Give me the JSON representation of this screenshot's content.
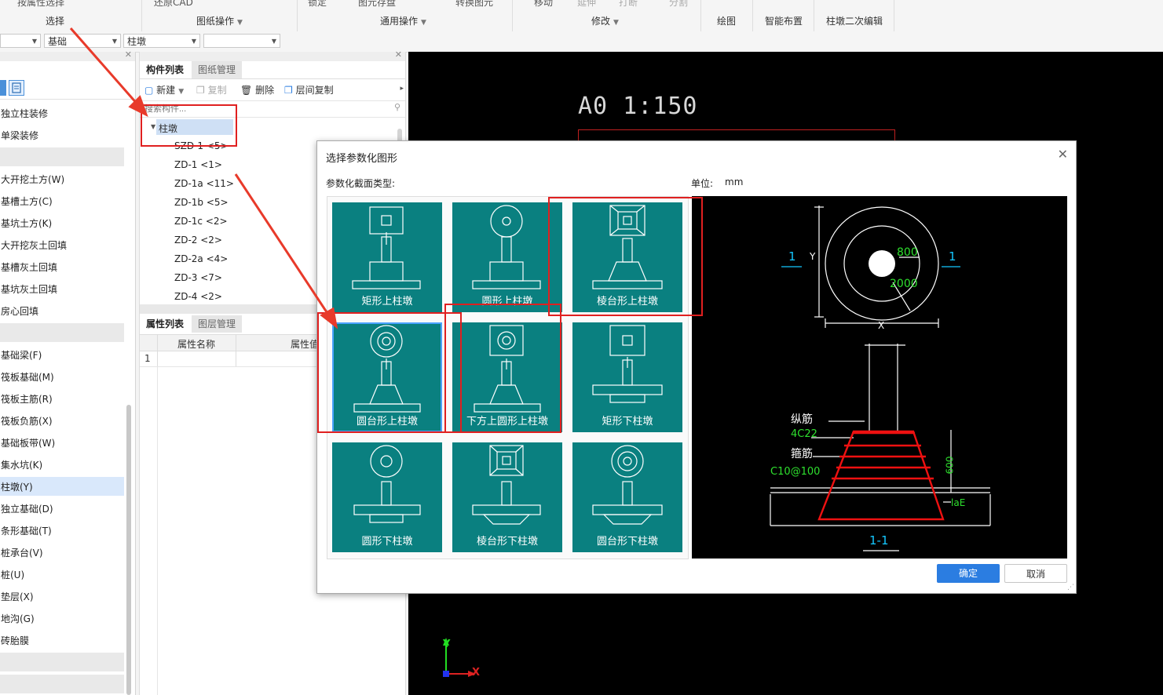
{
  "ribbon": {
    "top_labels": [
      "按属性选择",
      "还原CAD",
      "锁定",
      "图元存盘",
      "转换图元",
      "移动",
      "延伸",
      "打断",
      "分割"
    ],
    "groups": [
      "选择",
      "图纸操作",
      "通用操作",
      "修改",
      "绘图",
      "智能布置",
      "柱墩二次编辑"
    ]
  },
  "selectors": {
    "floor": "",
    "category": "基础",
    "type": "柱墩",
    "instance": ""
  },
  "left_panel": {
    "items_top": [
      "独立柱装修",
      "单梁装修"
    ],
    "items_earth": [
      "大开挖土方(W)",
      "基槽土方(C)",
      "基坑土方(K)",
      "大开挖灰土回填",
      "基槽灰土回填",
      "基坑灰土回填",
      "房心回填"
    ],
    "items_foundation": [
      "基础梁(F)",
      "筏板基础(M)",
      "筏板主筋(R)",
      "筏板负筋(X)",
      "基础板带(W)",
      "集水坑(K)",
      "柱墩(Y)",
      "独立基础(D)",
      "条形基础(T)",
      "桩承台(V)",
      "桩(U)",
      "垫层(X)",
      "地沟(G)",
      "砖胎膜"
    ]
  },
  "mid_panel": {
    "tabs_top": [
      "构件列表",
      "图纸管理"
    ],
    "toolbar": {
      "new": "新建",
      "copy": "复制",
      "delete": "删除",
      "floor_copy": "层间复制"
    },
    "search_placeholder": "搜索构件...",
    "tree_root": "柱墩",
    "tree_items": [
      "SZD-1 <5>",
      "ZD-1 <1>",
      "ZD-1a <11>",
      "ZD-1b <5>",
      "ZD-1c <2>",
      "ZD-2 <2>",
      "ZD-2a <4>",
      "ZD-3 <7>",
      "ZD-4 <2>"
    ],
    "tabs_bottom": [
      "属性列表",
      "图层管理"
    ],
    "prop_headers": [
      "属性名称",
      "属性值"
    ],
    "prop_row_index": "1"
  },
  "cad": {
    "title": "A0  1:150",
    "axis_y": "Y",
    "axis_x": "X"
  },
  "dialog": {
    "title": "选择参数化图形",
    "section_label": "参数化截面类型:",
    "unit_label": "单位:",
    "unit_value": "mm",
    "tiles": [
      "矩形上柱墩",
      "圆形上柱墩",
      "棱台形上柱墩",
      "圆台形上柱墩",
      "下方上圆形上柱墩",
      "矩形下柱墩",
      "圆形下柱墩",
      "棱台形下柱墩",
      "圆台形下柱墩"
    ],
    "preview": {
      "label_1_left": "1",
      "label_1_right": "1",
      "dim_800": "800",
      "dim_2000": "2000",
      "label_x": "X",
      "label_y": "Y",
      "zongjin": "纵筋",
      "zongjin_val": "4C22",
      "gujin": "箍筋",
      "gujin_val": "C10@100",
      "dim_600": "600",
      "lae": "laE",
      "section": "1-1"
    },
    "ok": "确定",
    "cancel": "取消"
  },
  "colors": {
    "tile_bg": "#0a8080",
    "accent_blue": "#2b7de1",
    "annotation_red": "#e02020"
  }
}
